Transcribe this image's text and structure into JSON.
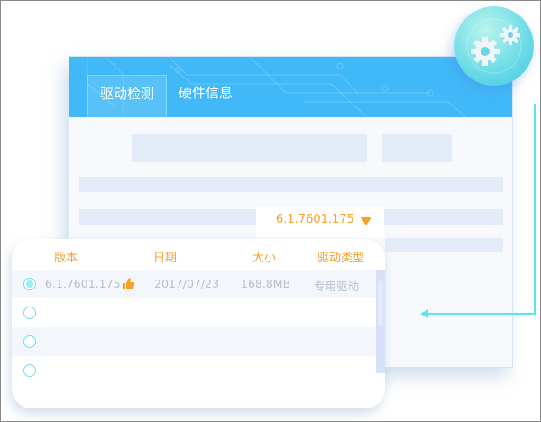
{
  "tabs": [
    {
      "label": "驱动检测"
    },
    {
      "label": "硬件信息"
    }
  ],
  "dropdown": {
    "value": "6.1.7601.175"
  },
  "table": {
    "headers": [
      "版本",
      "日期",
      "大小",
      "驱动类型"
    ],
    "rows": [
      {
        "version": "6.1.7601.175",
        "date": "2017/07/23",
        "size": "168.8MB",
        "type": "专用驱动",
        "selected": true,
        "recommended": true
      },
      {
        "selected": false
      },
      {
        "selected": false
      },
      {
        "selected": false
      }
    ]
  },
  "colors": {
    "header": "#41b9f8",
    "accent": "#f5a12a",
    "connector": "#55e6ee"
  }
}
